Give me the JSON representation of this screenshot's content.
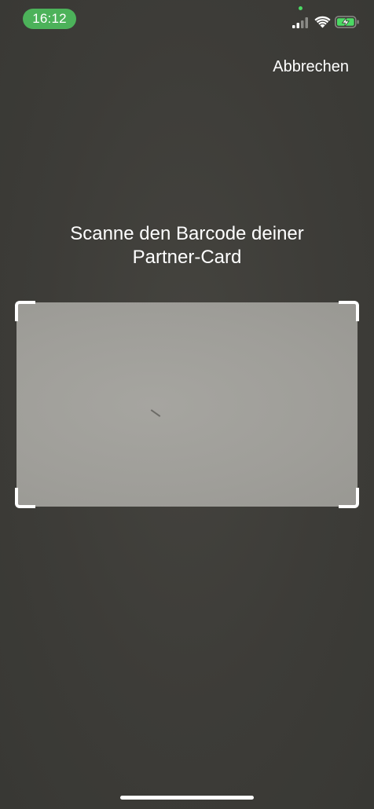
{
  "status_bar": {
    "time": "16:12",
    "icons": [
      "cellular-signal-icon",
      "wifi-icon",
      "battery-charging-icon"
    ],
    "time_pill_color": "#4cb25a",
    "privacy_indicator_color": "#4cd964"
  },
  "header": {
    "cancel_label": "Abbrechen"
  },
  "scanner": {
    "instruction_line1": "Scanne den Barcode deiner",
    "instruction_line2": "Partner-Card"
  },
  "colors": {
    "background": "#3d3c38",
    "frame": "#ffffff",
    "scan_area": "#9f9e99"
  }
}
